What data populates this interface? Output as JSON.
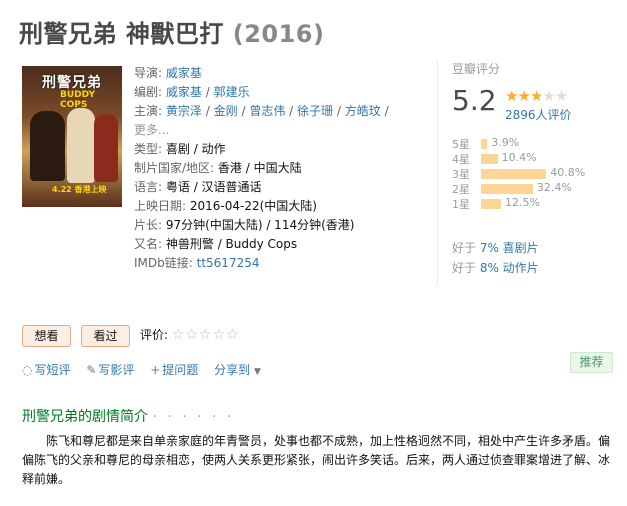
{
  "movie": {
    "title": "刑警兄弟 神獸巴打",
    "year": "(2016)"
  },
  "poster": {
    "title_text": "刑警兄弟",
    "sub_text": "BUDDY COPS",
    "date_text": "4.22 香港上映"
  },
  "info": {
    "director_label": "导演:",
    "director": "威家基",
    "writer_label": "编剧:",
    "writers": [
      "威家基",
      "郭建乐"
    ],
    "cast_label": "主演:",
    "cast": [
      "黄宗泽",
      "金刚",
      "曾志伟",
      "徐子珊",
      "方皓玟"
    ],
    "more": "更多...",
    "genre_label": "类型:",
    "genre": "喜剧 / 动作",
    "country_label": "制片国家/地区:",
    "country": "香港 / 中国大陆",
    "language_label": "语言:",
    "language": "粤语 / 汉语普通话",
    "release_label": "上映日期:",
    "release": "2016-04-22(中国大陆)",
    "runtime_label": "片长:",
    "runtime": "97分钟(中国大陆) / 114分钟(香港)",
    "aka_label": "又名:",
    "aka": "神兽刑警 / Buddy Cops",
    "imdb_label": "IMDb链接:",
    "imdb": "tt5617254"
  },
  "rating": {
    "label": "豆瓣评分",
    "score": "5.2",
    "stars_filled": 2.5,
    "votes": "2896人评价",
    "distribution": [
      {
        "label": "5星",
        "pct": "3.9%",
        "value": 3.9
      },
      {
        "label": "4星",
        "pct": "10.4%",
        "value": 10.4
      },
      {
        "label": "3星",
        "pct": "40.8%",
        "value": 40.8
      },
      {
        "label": "2星",
        "pct": "32.4%",
        "value": 32.4
      },
      {
        "label": "1星",
        "pct": "12.5%",
        "value": 12.5
      }
    ],
    "better_than": [
      {
        "prefix": "好于 ",
        "link": "7% 喜剧片"
      },
      {
        "prefix": "好于 ",
        "link": "8% 动作片"
      }
    ]
  },
  "buttons": {
    "want": "想看",
    "seen": "看过",
    "my_rating_label": "评价:"
  },
  "actions": {
    "short_review": "写短评",
    "review": "写影评",
    "question": "提问题",
    "share": "分享到",
    "recommend": "推荐"
  },
  "summary": {
    "title": "刑警兄弟的剧情简介",
    "dots": "· · · · · ·",
    "text": "陈飞和尊尼都是来自单亲家庭的年青警员，处事也都不成熟，加上性格迥然不同，相处中产生许多矛盾。偏偏陈飞的父亲和尊尼的母亲相恋，使两人关系更形紧张，闹出许多笑话。后来，两人通过侦查罪案增进了解、冰释前嫌。"
  },
  "colors": {
    "link": "#3377aa",
    "star": "#ffac2d",
    "bar": "#ffd596",
    "section_green": "#007722"
  }
}
